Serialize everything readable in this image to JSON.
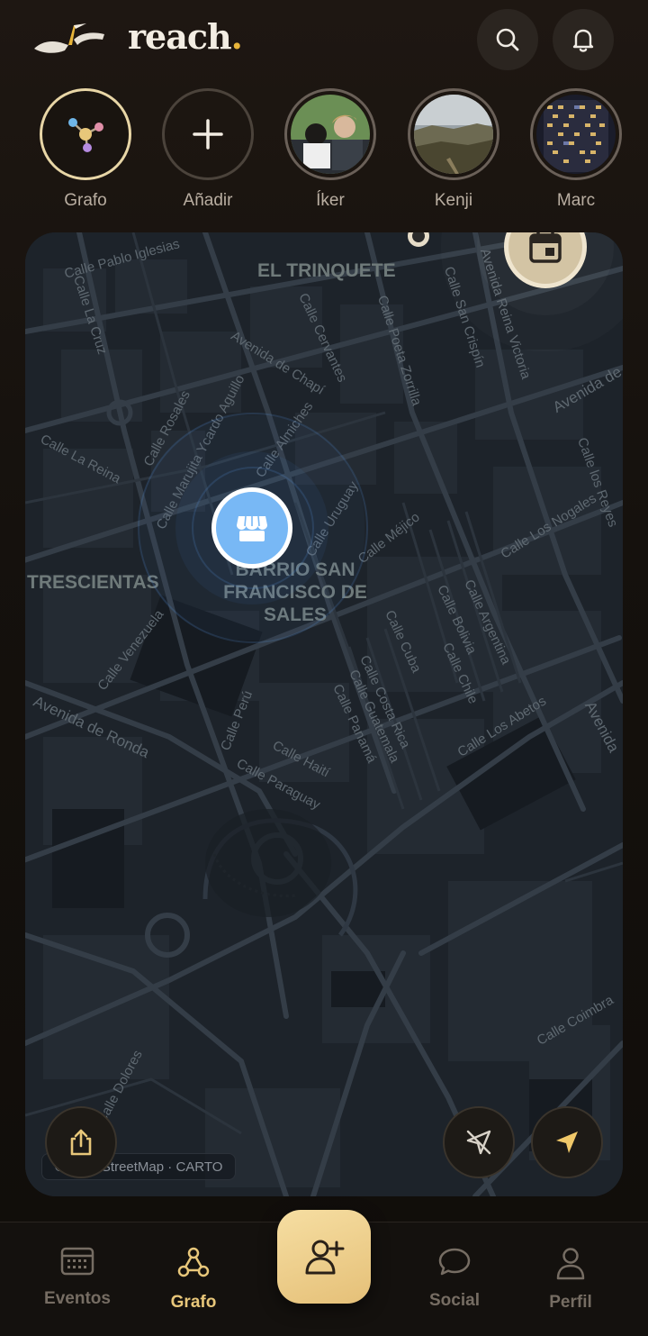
{
  "app": {
    "name": "reach",
    "dot": "."
  },
  "colors": {
    "accent": "#e8c77a",
    "brand_dot": "#e8b53a",
    "poi": "#78b8f5"
  },
  "header": {
    "search_icon": "search-icon",
    "notifications_icon": "bell-icon"
  },
  "stories": [
    {
      "label": "Grafo",
      "type": "graph"
    },
    {
      "label": "Añadir",
      "type": "add"
    },
    {
      "label": "Íker",
      "type": "photo"
    },
    {
      "label": "Kenji",
      "type": "photo"
    },
    {
      "label": "Marc",
      "type": "photo"
    }
  ],
  "map": {
    "neighborhoods": {
      "trinquete": "EL TRINQUETE",
      "san_francisco": "BARRIO SAN\nFRANCISCO DE\nSALES",
      "trescientas": "TRESCIENTAS"
    },
    "streets": {
      "pablo_iglesias": "Calle Pablo Iglesias",
      "la_cruz": "Calle La Cruz",
      "cervantes": "Calle Cervantes",
      "poeta_zorrilla": "Calle Poeta Zorrilla",
      "san_crispin": "Calle San Crispín",
      "reina_victoria": "Avenida Reina Victoria",
      "chapi": "Avenida de Chapí",
      "rosales": "Calle Rosales",
      "la_reina": "Calle La Reina",
      "marujita": "Calle Marujita Ycardo Aguillo",
      "almiches": "Calle Almiches",
      "uruguay": "Calle Uruguay",
      "mejico": "Calle Méjico",
      "nogales": "Calle Los Nogales",
      "los_reyes": "Calle los Reyes",
      "venezuela": "Calle Venezuela",
      "argentina": "Calle Argentina",
      "bolivia": "Calle Bolivia",
      "cuba": "Calle Cuba",
      "chile": "Calle Chile",
      "costa_rica": "Calle Costa Rica",
      "guatemala": "Calle Guatemala",
      "panama": "Calle Panamá",
      "abetos": "Calle Los Abetos",
      "ronda": "Avenida de Ronda",
      "peru": "Calle Perú",
      "haiti": "Calle Haití",
      "paraguay": "Calle Paraguay",
      "coimbra": "Calle Coimbra",
      "dolores": "Calle Dolores",
      "avenida_right": "Avenida"
    },
    "attribution": "© OpenStreetMap · CARTO"
  },
  "nav": {
    "items": [
      {
        "label": "Eventos"
      },
      {
        "label": "Grafo"
      },
      {
        "label": "Social"
      },
      {
        "label": "Perfil"
      }
    ],
    "active": "Grafo"
  }
}
